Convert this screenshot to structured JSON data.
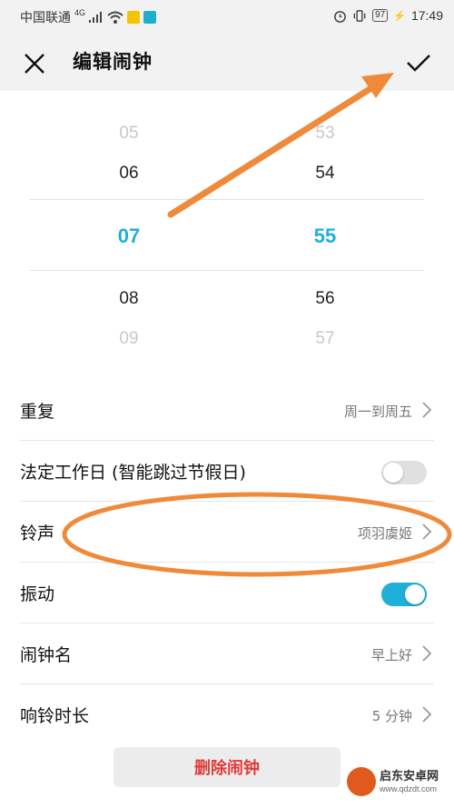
{
  "status_bar": {
    "carrier": "中国联通",
    "network": "4G",
    "battery": "97",
    "time": "17:49"
  },
  "header": {
    "title": "编辑闹钟"
  },
  "picker": {
    "hours": [
      "05",
      "06",
      "07",
      "08",
      "09"
    ],
    "minutes": [
      "53",
      "54",
      "55",
      "56",
      "57"
    ],
    "selected_hour": "07",
    "selected_minute": "55"
  },
  "settings": {
    "repeat": {
      "label": "重复",
      "value": "周一到周五"
    },
    "workday": {
      "label": "法定工作日 (智能跳过节假日)",
      "enabled": false
    },
    "ringtone": {
      "label": "铃声",
      "value": "项羽虞姬"
    },
    "vibrate": {
      "label": "振动",
      "enabled": true
    },
    "name": {
      "label": "闹钟名",
      "value": "早上好"
    },
    "duration": {
      "label": "响铃时长",
      "value": "5 分钟"
    }
  },
  "delete_label": "删除闹钟",
  "colors": {
    "accent": "#1eb0d6",
    "danger": "#e03b3b",
    "annotation": "#ef8a3a"
  },
  "watermark": {
    "name": "启东安卓网",
    "url": "www.qdzdt.com"
  }
}
